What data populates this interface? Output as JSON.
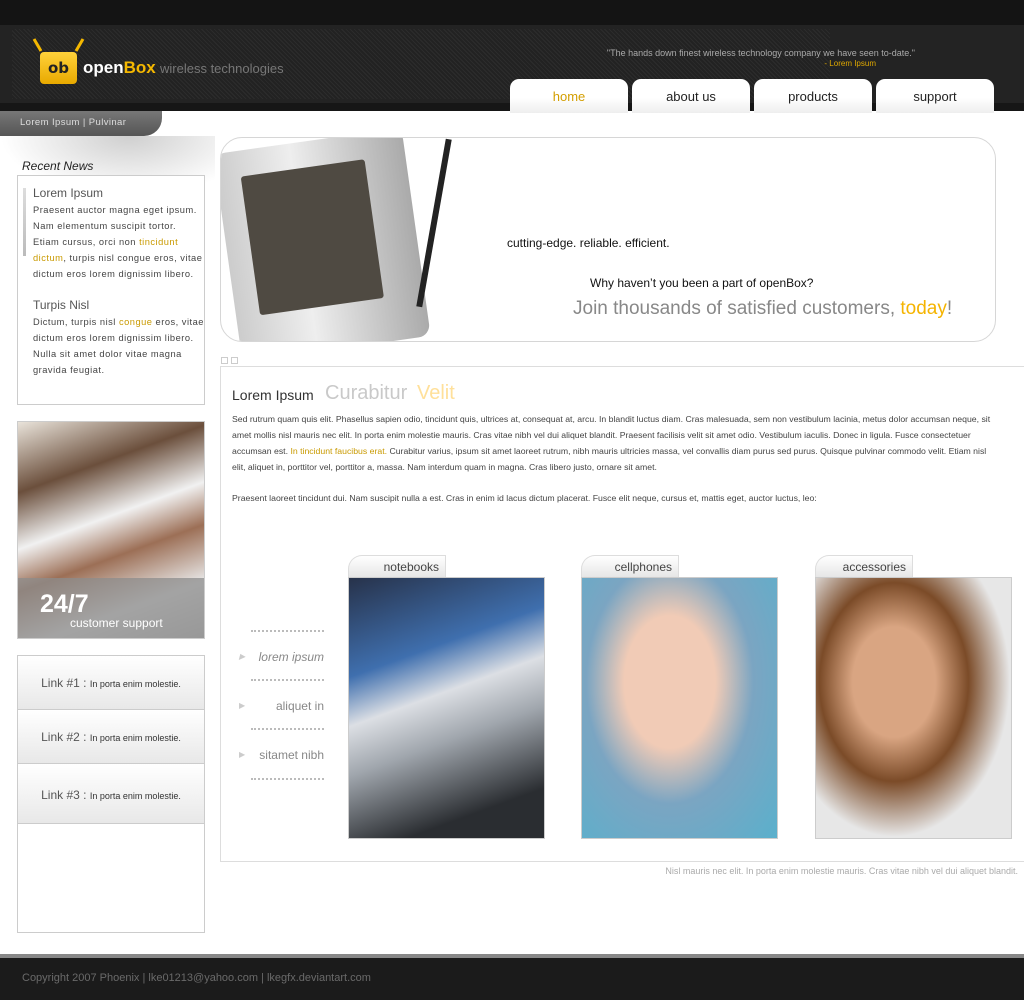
{
  "header": {
    "logo_mark": "ob",
    "brand_open": "open",
    "brand_box": "Box",
    "brand_sub": "wireless technologies",
    "quote": "\"The hands down finest wireless technology company we have seen to-date.\"",
    "quote_author": "- Lorem Ipsum"
  },
  "nav": {
    "tabs": [
      {
        "label": "home",
        "active": true
      },
      {
        "label": "about us"
      },
      {
        "label": "products"
      },
      {
        "label": "support"
      }
    ],
    "active_color": "#d39e00"
  },
  "breadcrumb": "Lorem Ipsum | Pulvinar",
  "sidebar": {
    "news_heading": "Recent News",
    "news": [
      {
        "title": "Lorem Ipsum",
        "text_a": "Praesent auctor magna eget ipsum. Nam elementum suscipit tortor. Etiam cursus, orci non ",
        "highlight": "tincidunt dictum",
        "text_b": ", turpis nisl congue eros, vitae dictum eros lorem dignissim libero."
      },
      {
        "title": "Turpis Nisl",
        "text_a": "Dictum, turpis nisl ",
        "highlight": "congue",
        "text_b": " eros, vitae dictum eros lorem dignissim libero. Nulla sit amet dolor vitae magna gravida feugiat."
      }
    ],
    "support_big": "24/7",
    "support_small": "customer support",
    "links": [
      {
        "label": "Link #1 :",
        "desc": "In porta enim molestie."
      },
      {
        "label": "Link #2 :",
        "desc": "In porta enim molestie."
      },
      {
        "label": "Link #3 :",
        "desc": "In porta enim molestie."
      }
    ]
  },
  "hero": {
    "tagline": "cutting-edge. reliable. efficient.",
    "question": "Why haven’t you been a part of openBox?",
    "cta_a": "Join thousands of satisfied customers, ",
    "cta_highlight": "today",
    "cta_b": "!"
  },
  "content": {
    "title": "Lorem Ipsum",
    "subtitle_a": "Curabitur",
    "subtitle_b": "Velit",
    "p1_a": "Sed rutrum quam quis elit. Phasellus sapien odio, tincidunt quis, ultrices at, consequat at, arcu. In blandit luctus diam. Cras malesuada, sem non vestibulum lacinia, metus dolor accumsan neque, sit amet mollis nisl mauris nec elit. In porta enim molestie mauris. Cras vitae nibh vel dui aliquet blandit. Praesent facilisis velit sit amet odio. Vestibulum iaculis. Donec in ligula. Fusce consectetuer accumsan est. ",
    "p1_highlight": "In tincidunt faucibus erat.",
    "p1_b": " Curabitur varius, ipsum sit amet laoreet rutrum, nibh mauris ultricies massa, vel convallis diam purus sed purus. Quisque pulvinar commodo velit. Etiam nisl elit, aliquet in, porttitor vel, porttitor a, massa. Nam interdum quam in magna. Cras libero justo, ornare sit amet.",
    "p2": "Praesent laoreet tincidunt dui. Nam suscipit nulla a est. Cras in enim id lacus dictum placerat. Fusce elit neque, cursus et, mattis eget, auctor luctus, leo:",
    "side_menu": [
      "lorem ipsum",
      "aliquet in",
      "sitamet nibh"
    ],
    "products": [
      {
        "label": "notebooks"
      },
      {
        "label": "cellphones"
      },
      {
        "label": "accessories"
      }
    ],
    "footnote": "Nisl mauris nec elit. In porta enim molestie mauris. Cras vitae nibh vel dui aliquet blandit."
  },
  "footer": {
    "text": "Copyright 2007 Phoenix | lke01213@yahoo.com | lkegfx.deviantart.com"
  }
}
